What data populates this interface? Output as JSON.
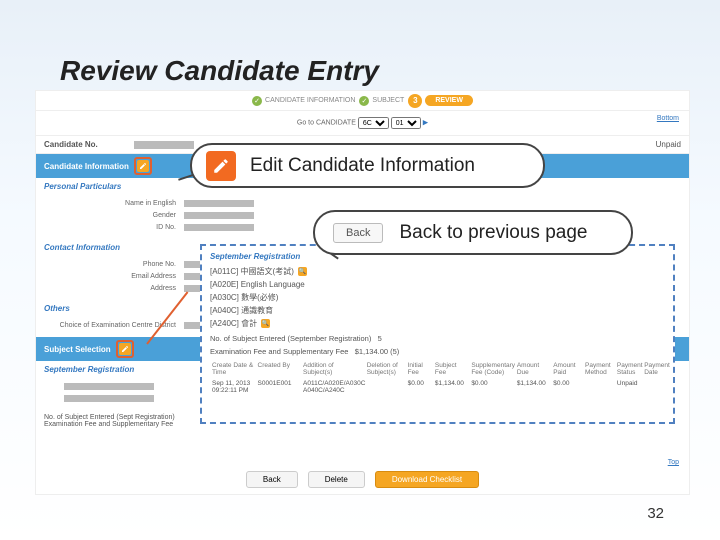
{
  "slide": {
    "title": "Review Candidate Entry",
    "number": "32"
  },
  "steps": {
    "s1": "CANDIDATE INFORMATION",
    "s2": "SUBJECT",
    "s3_num": "3",
    "s3_label": "REVIEW"
  },
  "links": {
    "bottom": "Bottom",
    "top": "Top"
  },
  "goto": {
    "label": "Go to CANDIDATE",
    "opt1": "6C",
    "opt2": "01"
  },
  "row_cand": {
    "label": "Candidate No.",
    "status": "Unpaid"
  },
  "sections": {
    "cand_info": "Candidate Information",
    "personal": "Personal Particulars",
    "contact": "Contact Information",
    "others": "Others",
    "subj_sel": "Subject Selection",
    "sept_reg": "September Registration"
  },
  "fields": {
    "name_en": "Name in English",
    "gender": "Gender",
    "idno": "ID No.",
    "phone": "Phone No.",
    "email": "Email Address",
    "address": "Address",
    "centre": "Choice of Examination Centre District"
  },
  "totals": {
    "line1": "No. of Subject Entered (Sept Registration)",
    "line2": "Examination Fee and Supplementary Fee"
  },
  "buttons": {
    "back": "Back",
    "delete": "Delete",
    "download": "Download Checklist"
  },
  "callout1": {
    "text": "Edit Candidate Information"
  },
  "callout2": {
    "btn": "Back",
    "text": "Back to previous page"
  },
  "popup": {
    "title": "September Registration",
    "subjects": [
      "[A011C] 中國語文(考試)",
      "[A020E] English Language",
      "[A030C] 數學(必修)",
      "[A040C] 通識教育",
      "[A240C] 會計"
    ],
    "sum1_label": "No. of Subject Entered (September Registration)",
    "sum1_val": "5",
    "sum2_label": "Examination Fee and Supplementary Fee",
    "sum2_val": "$1,134.00 (5)",
    "headers": {
      "h1": "Create Date & Time",
      "h2": "Created By",
      "h3": "Addition of Subject(s)",
      "h4": "Deletion of Subject(s)",
      "h5": "Initial Fee",
      "h6": "Subject Fee",
      "h7": "Supplementary Fee (Code)",
      "h8": "Amount Due",
      "h9": "Amount Paid",
      "h10": "Payment Method",
      "h11": "Payment Status",
      "h12": "Payment Date"
    },
    "row": {
      "c1": "Sep 11, 2013 09:22:11 PM",
      "c2": "S0001E001",
      "c3": "A011C/A020E/A030C A040C/A240C",
      "c4": "",
      "c5": "$0.00",
      "c6": "$1,134.00",
      "c7": "$0.00",
      "c8": "$1,134.00",
      "c9": "$0.00",
      "c10": "",
      "c11": "Unpaid",
      "c12": ""
    }
  }
}
